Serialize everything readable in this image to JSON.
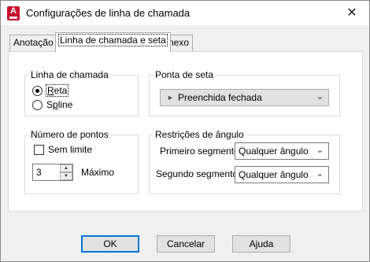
{
  "window": {
    "title": "Configurações de linha de chamada",
    "app_icon_letter": "A",
    "close_glyph": "✕"
  },
  "tabs": [
    {
      "label": "Anotação",
      "active": false
    },
    {
      "label": "Linha de chamada e seta",
      "active": true
    },
    {
      "label": "Anexo",
      "active": false
    }
  ],
  "leader_line": {
    "group_title": "Linha de chamada",
    "options": [
      {
        "label_pre": "",
        "label_mnemonic": "R",
        "label_post": "eta",
        "selected": true
      },
      {
        "label_pre": "S",
        "label_mnemonic": "p",
        "label_post": "line",
        "selected": false
      }
    ]
  },
  "arrowhead": {
    "group_title": "Ponta de seta",
    "selected_icon": "arrow-right-icon",
    "selected_value": "Preenchida fechada"
  },
  "number_of_points": {
    "group_title": "Número de pontos",
    "no_limit_label": "Sem limite",
    "no_limit_checked": false,
    "value": "3",
    "max_label": "Máximo"
  },
  "angle_constraints": {
    "group_title": "Restrições de ângulo",
    "first_segment_label": "Primeiro segmento:",
    "first_segment_value": "Qualquer ângulo",
    "second_segment_label": "Segundo segmento:",
    "second_segment_value": "Qualquer ângulo"
  },
  "buttons": {
    "ok": "OK",
    "cancel": "Cancelar",
    "help_pre": "A",
    "help_mnemonic": "j",
    "help_post": "uda"
  },
  "colors": {
    "accent": "#0078d7",
    "app_icon": "#c8102e"
  }
}
